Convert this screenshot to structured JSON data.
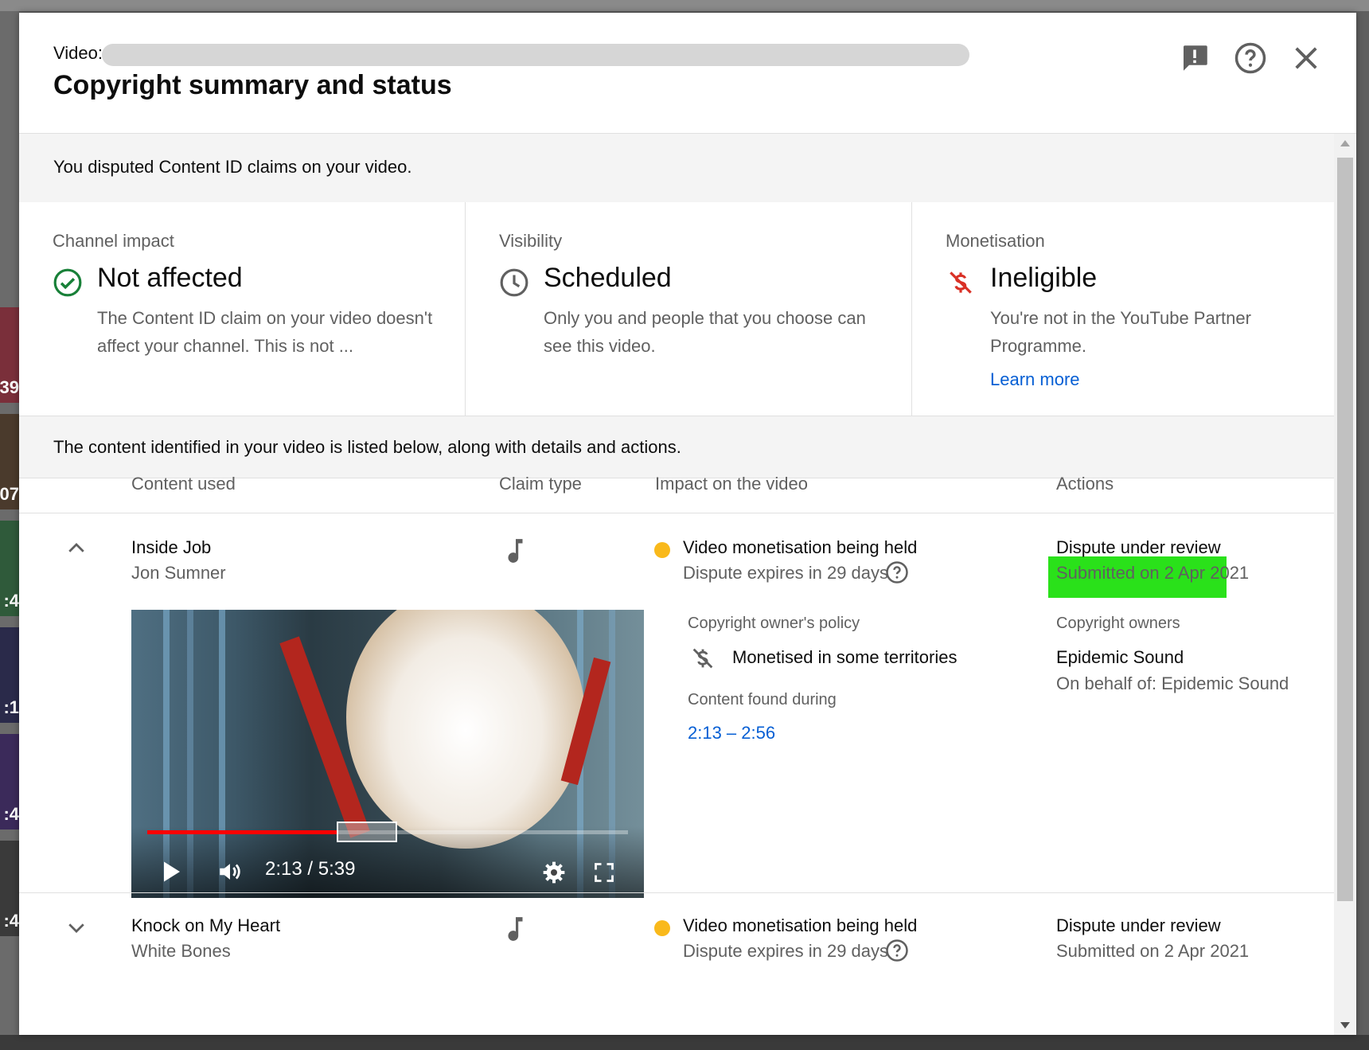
{
  "header": {
    "video_label": "Video:",
    "title": "Copyright summary and status",
    "icons": [
      "feedback-icon",
      "help-icon",
      "close-icon"
    ]
  },
  "summary_text": "You disputed Content ID claims on your video.",
  "cards": [
    {
      "label": "Channel impact",
      "status": "Not affected",
      "icon": "check-circle-icon",
      "description": "The Content ID claim on your video doesn't affect your channel. This is not ..."
    },
    {
      "label": "Visibility",
      "status": "Scheduled",
      "icon": "clock-icon",
      "description": "Only you and people that you choose can see this video."
    },
    {
      "label": "Monetisation",
      "status": "Ineligible",
      "icon": "no-dollar-icon",
      "description": "You're not in the YouTube Partner Programme.",
      "link": "Learn more"
    }
  ],
  "content_intro": "The content identified in your video is listed below, along with details and actions.",
  "table": {
    "headers": [
      "Content used",
      "Claim type",
      "Impact on the video",
      "Actions"
    ],
    "rows": [
      {
        "title": "Inside Job",
        "artist": "Jon Sumner",
        "claim_type_icon": "music-note-icon",
        "impact": "Video monetisation being held",
        "impact_sub": "Dispute expires in 29 days",
        "action": "Dispute under review",
        "action_sub": "Submitted on 2 Apr 2021",
        "expanded": true,
        "player": {
          "time": "2:13 / 5:39",
          "progress": 0.395
        },
        "details": {
          "policy_label": "Copyright owner's policy",
          "policy_value": "Monetised in some territories",
          "found_label": "Content found during",
          "found_value": "2:13 – 2:56",
          "owners_label": "Copyright owners",
          "owner": "Epidemic Sound",
          "owner_sub": "On behalf of: Epidemic Sound"
        }
      },
      {
        "title": "Knock on My Heart",
        "artist": "White Bones",
        "claim_type_icon": "music-note-icon",
        "impact": "Video monetisation being held",
        "impact_sub": "Dispute expires in 29 days",
        "action": "Dispute under review",
        "action_sub": "Submitted on 2 Apr 2021",
        "expanded": false
      }
    ]
  },
  "background_timestamps": [
    ":39",
    ":07",
    ":4",
    ":1",
    ":4",
    ":4"
  ],
  "colors": {
    "accent_link": "#065fd4",
    "success": "#188038",
    "error": "#d93025",
    "highlight": "#2ae11a",
    "pending_dot": "#f9b91b"
  }
}
